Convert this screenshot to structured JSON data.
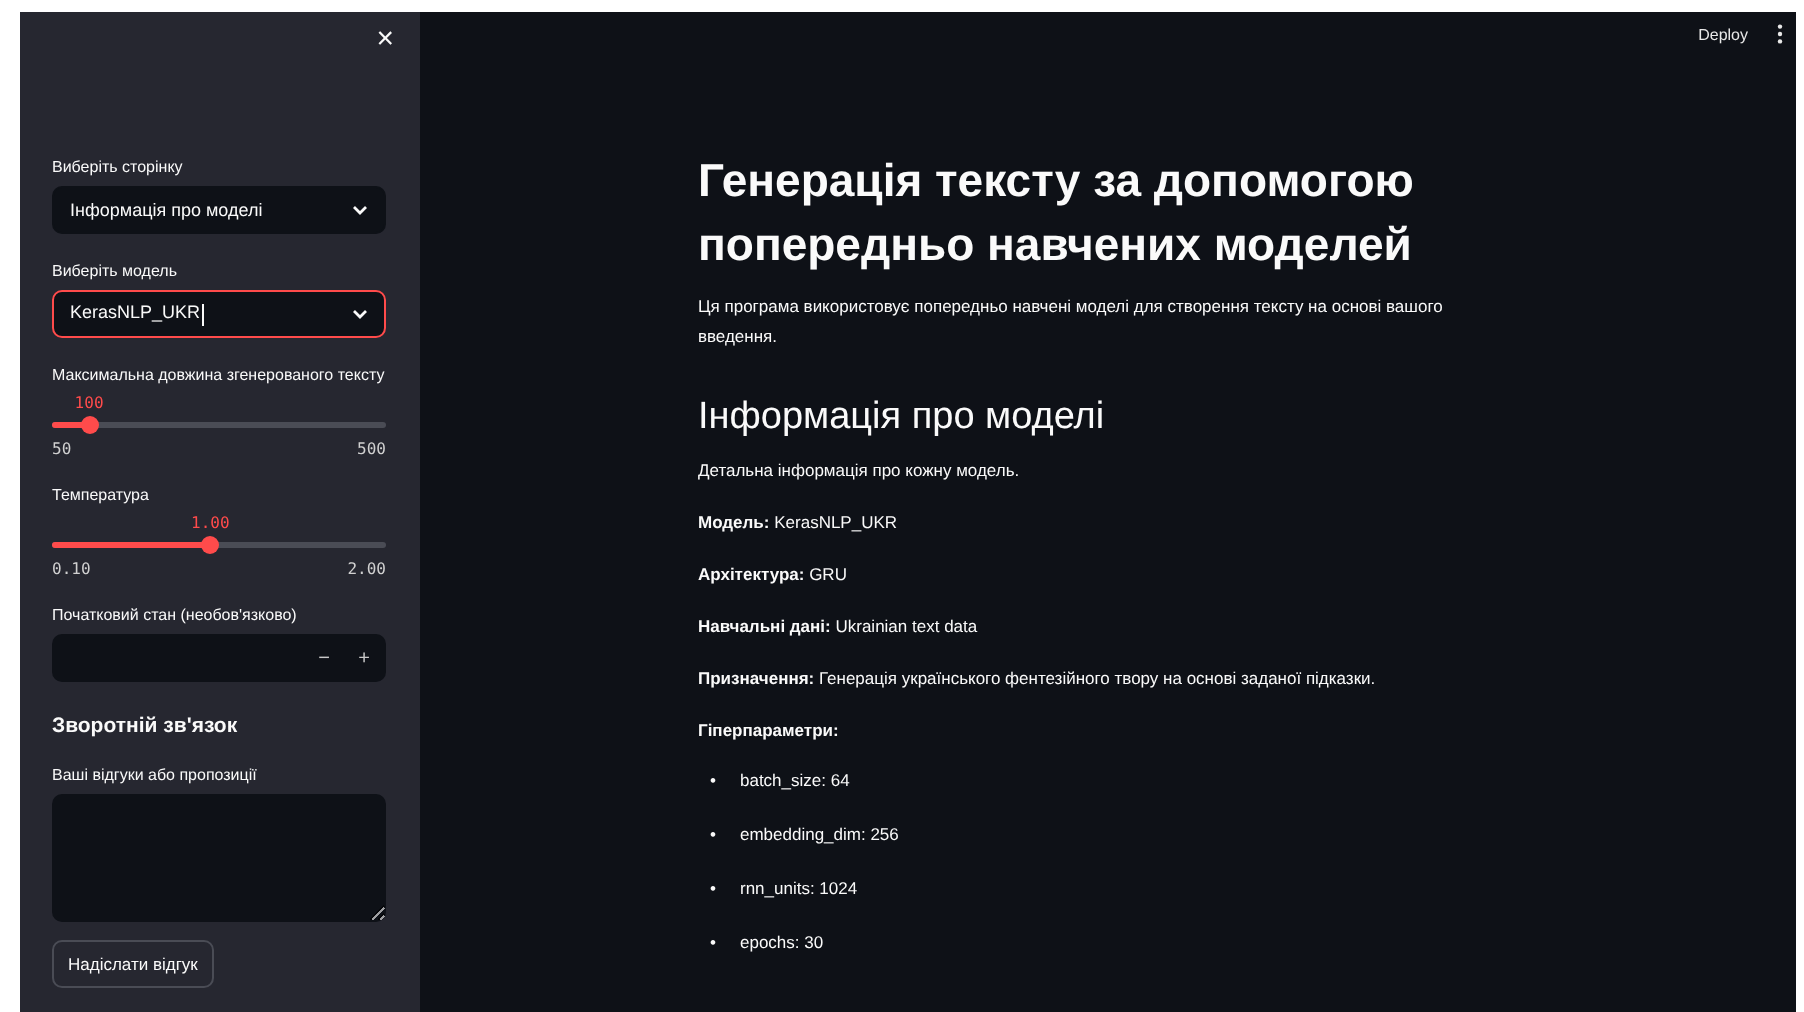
{
  "sidebar": {
    "close": "×",
    "page_select": {
      "label": "Виберіть сторінку",
      "value": "Інформація про моделі",
      "focused": false
    },
    "model_select": {
      "label": "Виберіть модель",
      "value": "KerasNLP_UKR",
      "focused": true
    },
    "sliders": [
      {
        "label": "Максимальна довжина згенерованого тексту",
        "value": "100",
        "level": 0.111,
        "min": "50",
        "max": "500"
      },
      {
        "label": "Температура",
        "value": "1.00",
        "level": 0.474,
        "min": "0.10",
        "max": "2.00"
      }
    ],
    "seed_input": {
      "label": "Початковий стан (необов'язково)",
      "minus": "−",
      "plus": "+"
    },
    "feedback": {
      "heading": "Зворотній зв'язок",
      "label": "Ваші відгуки або пропозиції",
      "button": "Надіслати відгук"
    }
  },
  "toolbar": {
    "deploy": "Deploy"
  },
  "main": {
    "title": "Генерація тексту за допомогою попередньо навчених моделей",
    "intro": "Ця програма використовує попередньо навчені моделі для створення тексту на основі вашого введення.",
    "section_title": "Інформація про моделі",
    "section_intro": "Детальна інформація про кожну модель.",
    "details": [
      "**Модель:** KerasNLP_UKR",
      "**Архітектура:** GRU",
      "**Навчальні дані:** Ukrainian text data",
      "**Призначення:** Генерація українського фентезійного твору на основі заданої підказки."
    ],
    "params_heading": "Гіперпараметри:",
    "bullet": "•",
    "params": [
      "batch_size: 64",
      "embedding_dim: 256",
      "rnn_units: 1024",
      "epochs: 30"
    ]
  }
}
